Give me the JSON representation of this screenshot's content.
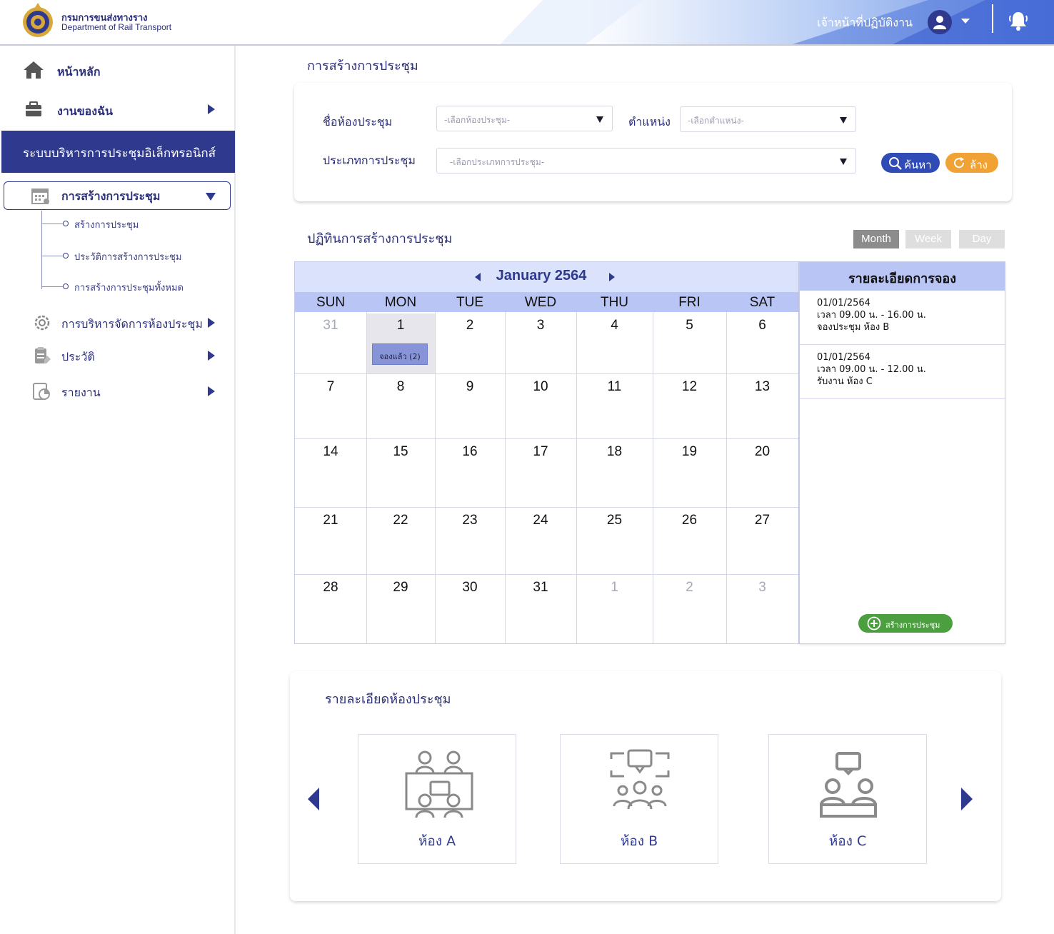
{
  "header": {
    "org_name_th": "กรมการขนส่งทางราง",
    "org_name_en": "Department of Rail Transport",
    "user_role": "เจ้าหน้าที่ปฏิบัติงาน",
    "icons": [
      "logo-emblem",
      "user-avatar-icon",
      "chevron-down-icon",
      "bell-icon"
    ],
    "accent": "#2f3a8f"
  },
  "sidebar": {
    "home": "หน้าหลัก",
    "my_work": "งานของฉัน",
    "system_title": "ระบบบริหารการประชุมอิเล็กทรอนิกส์",
    "meeting_create": "การสร้างการประชุม",
    "sub_items": [
      "สร้างการประชุม",
      "ประวัติการสร้างการประชุม",
      "การสร้างการประชุมทั้งหมด"
    ],
    "room_mgmt": "การบริหารจัดการห้องประชุม",
    "history": "ประวัติ",
    "report": "รายงาน"
  },
  "search": {
    "page_title": "การสร้างการประชุม",
    "room_label": "ชื่อห้องประชุม",
    "room_placeholder": "-เลือกห้องประชุม-",
    "position_label": "ตำแหน่ง",
    "position_placeholder": "-เลือกตำแหน่ง-",
    "type_label": "ประเภทการประชุม",
    "type_placeholder": "-เลือกประเภทการประชุม-",
    "search_button": "ค้นหา",
    "clear_button": "ล้าง"
  },
  "calendar": {
    "section_title": "ปฏิทินการสร้างการประชุม",
    "views": [
      "Month",
      "Week",
      "Day"
    ],
    "active_view": "Month",
    "month_label": "January 2564",
    "days_of_week": [
      "SUN",
      "MON",
      "TUE",
      "WED",
      "THU",
      "FRI",
      "SAT"
    ],
    "weeks": [
      [
        "31",
        "1",
        "2",
        "3",
        "4",
        "5",
        "6"
      ],
      [
        "7",
        "8",
        "9",
        "10",
        "11",
        "12",
        "13"
      ],
      [
        "14",
        "15",
        "16",
        "17",
        "18",
        "19",
        "20"
      ],
      [
        "21",
        "22",
        "23",
        "24",
        "25",
        "26",
        "27"
      ],
      [
        "28",
        "29",
        "30",
        "31",
        "1",
        "2",
        "3"
      ]
    ],
    "booked_chip": "จองแล้ว (2)"
  },
  "booking_detail": {
    "title": "รายละเอียดการจอง",
    "items": [
      {
        "date": "01/01/2564",
        "time": "เวลา 09.00 น. - 16.00 น.",
        "desc": "จองประชุม ห้อง B"
      },
      {
        "date": "01/01/2564",
        "time": "เวลา 09.00 น. - 12.00 น.",
        "desc": "รับงาน ห้อง C"
      }
    ],
    "create_button": "สร้างการประชุม"
  },
  "rooms": {
    "section_title": "รายละเอียดห้องประชุม",
    "items": [
      {
        "name": "ห้อง A",
        "icon": "meeting-room-a-icon"
      },
      {
        "name": "ห้อง B",
        "icon": "meeting-room-b-icon"
      },
      {
        "name": "ห้อง C",
        "icon": "meeting-room-c-icon"
      }
    ]
  }
}
